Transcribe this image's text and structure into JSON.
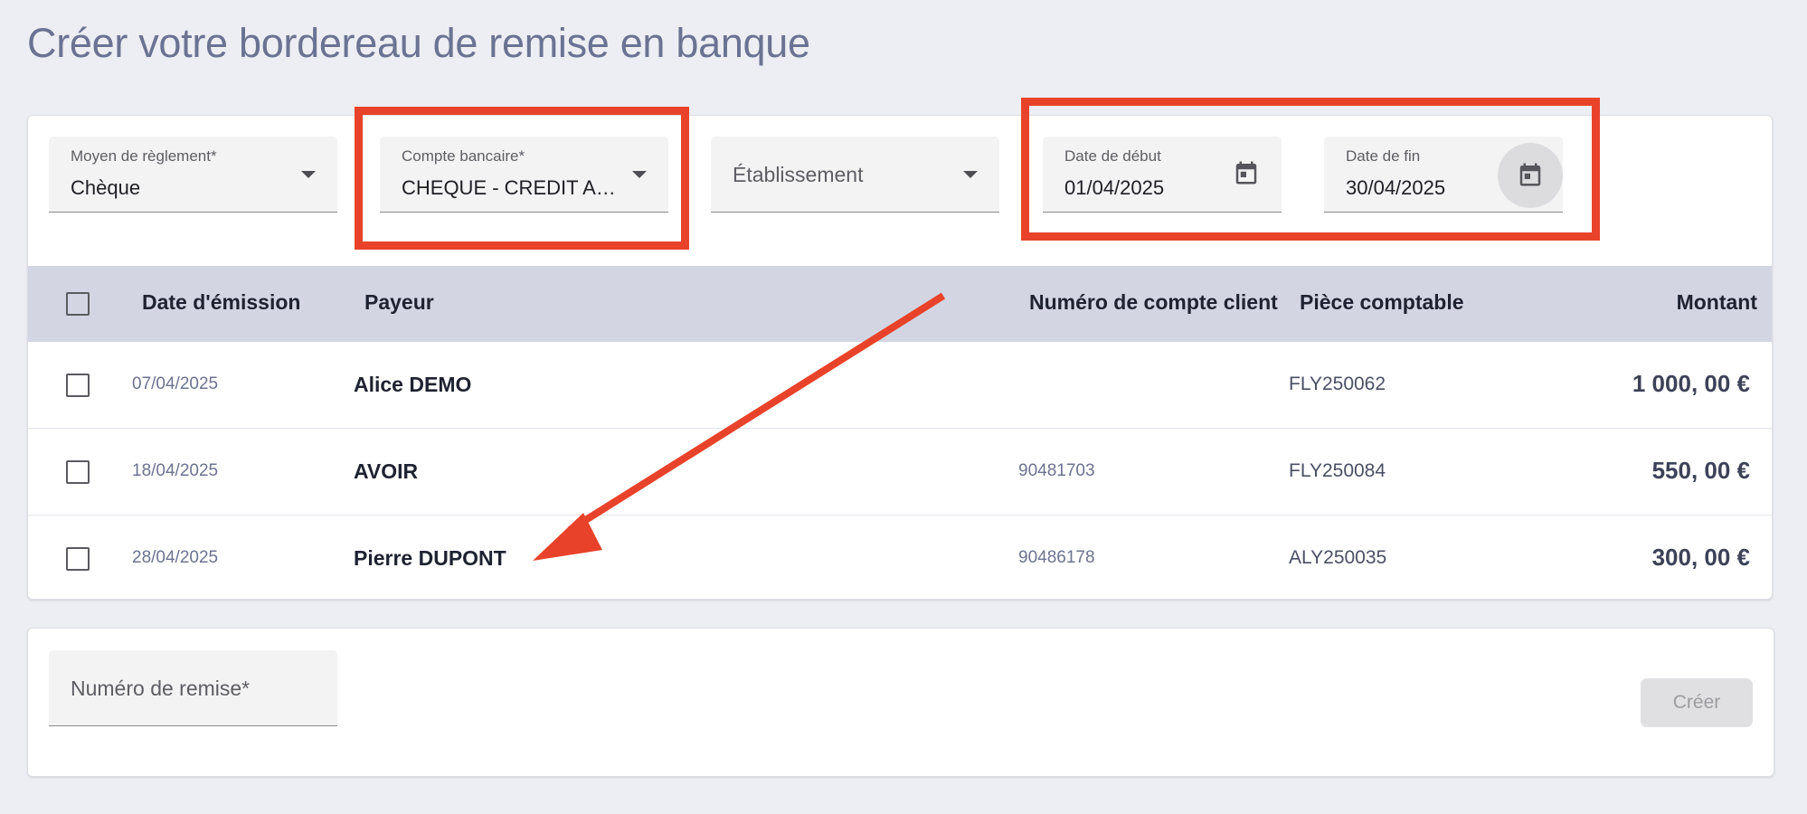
{
  "page": {
    "title": "Créer votre bordereau de remise en banque"
  },
  "filters": {
    "payment_method": {
      "label": "Moyen de règlement*",
      "value": "Chèque"
    },
    "bank_account": {
      "label": "Compte bancaire*",
      "value": "CHEQUE - CREDIT AGRI…"
    },
    "establishment": {
      "placeholder": "Établissement"
    },
    "start_date": {
      "label": "Date de début",
      "value": "01/04/2025"
    },
    "end_date": {
      "label": "Date de fin",
      "value": "30/04/2025"
    }
  },
  "table": {
    "headers": {
      "issue_date": "Date d'émission",
      "payer": "Payeur",
      "client_account": "Numéro de compte client",
      "accounting_doc": "Pièce comptable",
      "amount": "Montant"
    },
    "rows": [
      {
        "issue_date": "07/04/2025",
        "payer": "Alice DEMO",
        "client_account": "",
        "accounting_doc": "FLY250062",
        "amount": "1 000, 00  €"
      },
      {
        "issue_date": "18/04/2025",
        "payer": "AVOIR",
        "client_account": "90481703",
        "accounting_doc": "FLY250084",
        "amount": "550, 00  €"
      },
      {
        "issue_date": "28/04/2025",
        "payer": "Pierre DUPONT",
        "client_account": "90486178",
        "accounting_doc": "ALY250035",
        "amount": "300, 00  €"
      }
    ]
  },
  "remittance": {
    "number_field": {
      "placeholder": "Numéro de remise*"
    },
    "create_label": "Créer"
  },
  "icons": {
    "calendar": "calendar-icon",
    "dropdown": "chevron-down-icon"
  },
  "colors": {
    "annotation": "#e8432a",
    "title": "#6b7393",
    "table_header_bg": "#d3d6e2"
  }
}
